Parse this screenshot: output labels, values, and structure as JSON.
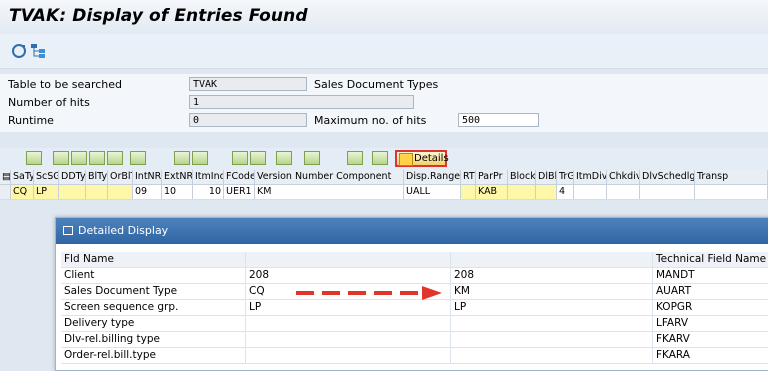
{
  "window": {
    "title": "TVAK: Display of Entries Found"
  },
  "toolbar": {
    "icons": [
      "refresh-icon",
      "hierarchy-icon"
    ]
  },
  "form": {
    "table_label": "Table to be searched",
    "table_value": "TVAK",
    "table_desc": "Sales Document Types",
    "hits_label": "Number of hits",
    "hits_value": "1",
    "runtime_label": "Runtime",
    "runtime_value": "0",
    "max_hits_label": "Maximum no. of hits",
    "max_hits_value": "500"
  },
  "alv_toolbar": {
    "details_label": "Details"
  },
  "grid": {
    "headers": [
      "SaTy",
      "ScSG",
      "DDTy",
      "BlTy",
      "OrBlT",
      "IntNR",
      "ExtNR",
      "ItmInc",
      "FCode",
      "Version Number Component",
      "Disp.Range",
      "RT",
      "ParPr",
      "Block",
      "DlBl",
      "TrG",
      "ItmDiv",
      "Chkdiv",
      "DlvSchedlg",
      "Transp"
    ],
    "row": [
      "CQ",
      "LP",
      "",
      "",
      "",
      "09",
      "10",
      "10",
      "UER1",
      "KM",
      "UALL",
      "",
      "KAB",
      "",
      "",
      "4",
      "",
      "",
      "",
      ""
    ]
  },
  "popup": {
    "title": "Detailed Display",
    "header": {
      "fld": "Fld Name",
      "col2": "",
      "col3": "",
      "tech": "Technical Field Name"
    },
    "rows": [
      {
        "fld": "Client",
        "v1": "208",
        "v2": "208",
        "tech": "MANDT"
      },
      {
        "fld": "Sales Document Type",
        "v1": "CQ",
        "v2": "KM",
        "tech": "AUART"
      },
      {
        "fld": "Screen sequence grp.",
        "v1": "LP",
        "v2": "LP",
        "tech": "KOPGR"
      },
      {
        "fld": "Delivery type",
        "v1": "",
        "v2": "",
        "tech": "LFARV"
      },
      {
        "fld": "Dlv-rel.billing type",
        "v1": "",
        "v2": "",
        "tech": "FKARV"
      },
      {
        "fld": "Order-rel.bill.type",
        "v1": "",
        "v2": "",
        "tech": "FKARA"
      }
    ]
  },
  "colors": {
    "popup_title": "#2e65a3",
    "highlight_border": "#dd3333",
    "arrow": "#e0352b"
  }
}
